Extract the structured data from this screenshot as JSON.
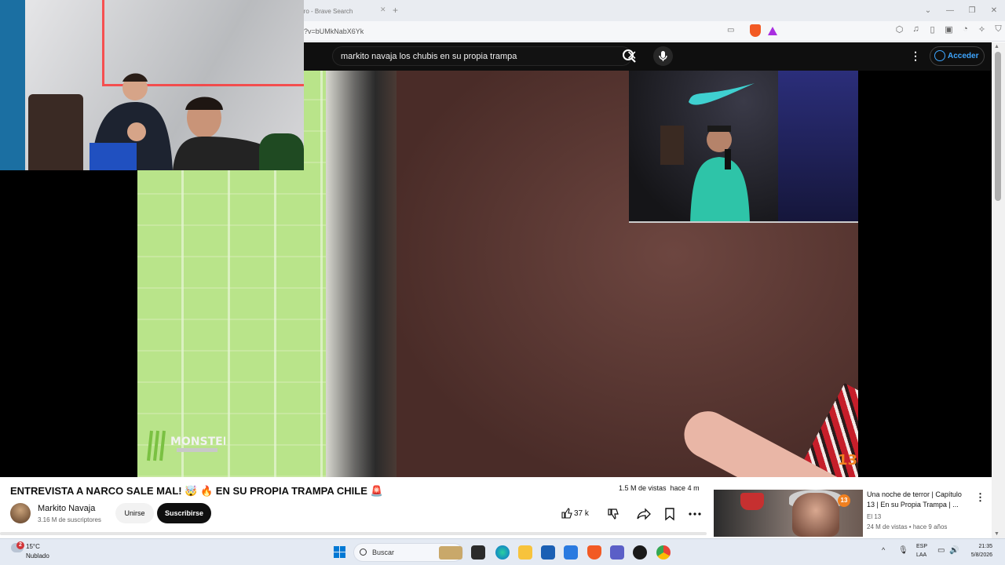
{
  "browser": {
    "tab_title": "rro - Brave Search",
    "url": "?v=bUMkNabX6Yk",
    "window_controls": [
      "—",
      "❐",
      "✕"
    ]
  },
  "youtube": {
    "search_query": "markito navaja los chubis en su propia trampa",
    "signin_label": "Acceder"
  },
  "video": {
    "title": "ENTREVISTA A NARCO SALE MAL! 🤯 🔥 EN SU PROPIA TRAMPA CHILE 🚨",
    "views": "1.5 M de vistas",
    "age": "hace 4 m",
    "watermark_number": "13",
    "logo_text": "MONSTER"
  },
  "channel": {
    "name": "Markito Navaja",
    "subscribers": "3.16 M de suscriptores",
    "join_label": "Unirse",
    "subscribe_label": "Suscribirse"
  },
  "actions": {
    "likes": "37 k"
  },
  "recommendation": {
    "title": "Una noche de terror | Capítulo 13 | En su Propia Trampa | ...",
    "channel": "El 13",
    "meta": "24 M de vistas • hace 9 años",
    "badge": "13"
  },
  "taskbar": {
    "temperature": "15°C",
    "condition": "Nublado",
    "weather_badge": "2",
    "search_label": "Buscar",
    "lang_top": "ESP",
    "lang_bottom": "LAA",
    "time": "21:35",
    "date": "5/8/2026"
  },
  "colors": {
    "youtube_bar": "#0f0f0f",
    "link_blue": "#3ea6ff",
    "brave_orange": "#f25a24",
    "windows_blue": "#0078d4"
  }
}
